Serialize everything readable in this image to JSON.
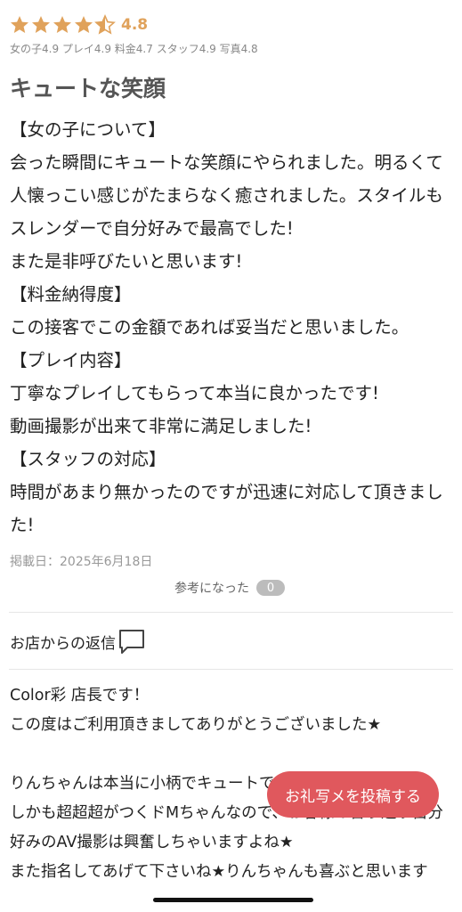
{
  "rating": {
    "stars": 4.8,
    "value_text": "4.8",
    "star_color": "#e0a25b",
    "sub_scores": "女の子4.9 プレイ4.9 料金4.7 スタッフ4.9 写真4.8"
  },
  "review": {
    "title": "キュートな笑顔",
    "lines": [
      "【女の子について】",
      "会った瞬間にキュートな笑顔にやられました。明るくて人懐っこい感じがたまらなく癒されました。スタイルもスレンダーで自分好みで最高でした!",
      "また是非呼びたいと思います!",
      "【料金納得度】",
      "この接客でこの金額であれば妥当だと思いました。",
      "【プレイ内容】",
      "丁寧なプレイしてもらって本当に良かったです!",
      "動画撮影が出来て非常に満足しました!",
      "【スタッフの対応】",
      "時間があまり無かったのですが迅速に対応して頂きました!"
    ],
    "post_date": "掲載日：2025年6月18日",
    "helpful_label": "参考になった",
    "helpful_count": "0"
  },
  "shop_reply": {
    "header": "お店からの返信",
    "icon": "speech-bubble-icon",
    "lines": [
      "Color彩 店長です！",
      "この度はご利用頂きましてありがとうございました★",
      "",
      "りんちゃんは本当に小柄でキュートですよね★",
      "しかも超超超がつくドMちゃんなので、お客様の言う通り自分好みのAV撮影は興奮しちゃいますよね★",
      "また指名してあげて下さいね★りんちゃんも喜ぶと思います"
    ]
  },
  "cta": {
    "label": "お礼写メを投稿する",
    "color": "#e0585d"
  }
}
